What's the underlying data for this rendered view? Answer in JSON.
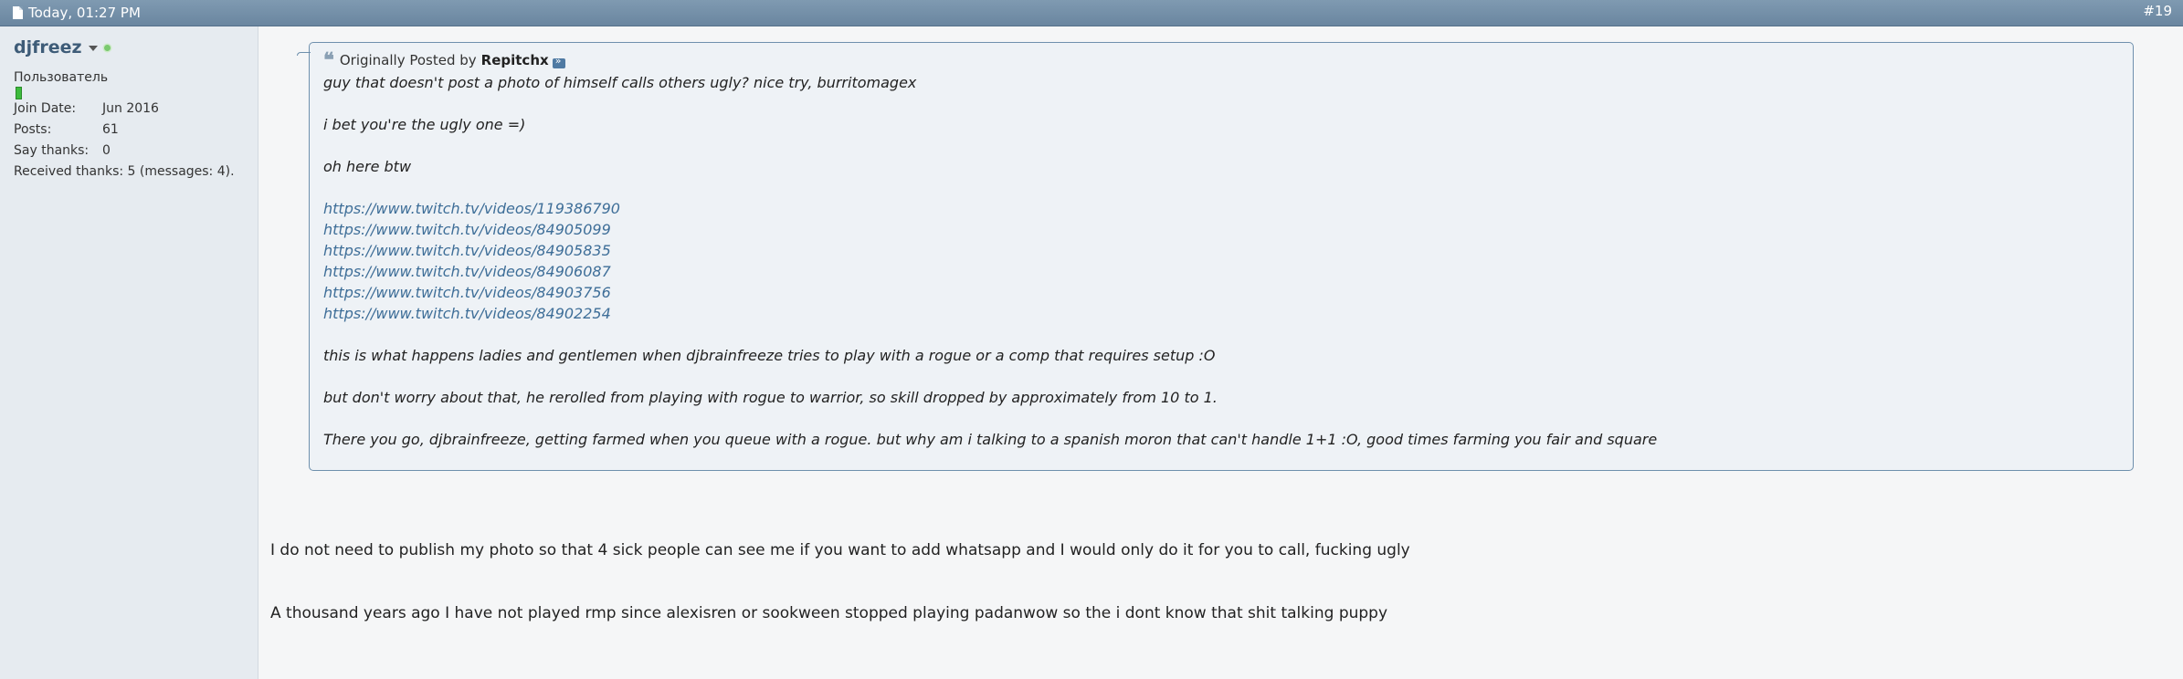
{
  "post": {
    "date": "Today, 01:27 PM",
    "number": "#19"
  },
  "user": {
    "name": "djfreez",
    "rank": "Пользователь",
    "stats": [
      {
        "label": "Join Date:",
        "value": "Jun 2016"
      },
      {
        "label": "Posts:",
        "value": "61"
      },
      {
        "label": "Say thanks:",
        "value": "0"
      }
    ],
    "received": "Received thanks: 5 (messages: 4)."
  },
  "quote": {
    "prefix": "Originally Posted by",
    "author": "Repitchx",
    "lines": [
      "guy that doesn't post a photo of himself calls others ugly? nice try, burritomagex",
      "i bet you're the ugly one =)",
      "oh here btw"
    ],
    "links": [
      "https://www.twitch.tv/videos/119386790",
      "https://www.twitch.tv/videos/84905099",
      "https://www.twitch.tv/videos/84905835",
      "https://www.twitch.tv/videos/84906087",
      "https://www.twitch.tv/videos/84903756",
      "https://www.twitch.tv/videos/84902254"
    ],
    "after": [
      "this is what happens ladies and gentlemen when djbrainfreeze tries to play with a rogue or a comp that requires setup :O",
      "but don't worry about that, he rerolled from playing with rogue to warrior, so skill dropped by approximately from 10 to 1.",
      "There you go, djbrainfreeze, getting farmed when you queue with a rogue. but why am i talking to a spanish moron that can't handle 1+1 :O, good times farming you fair and square"
    ]
  },
  "reply": [
    "I do not need to publish my photo so that 4 sick people can see me if you want to add whatsapp and I would only do it for you to call, fucking ugly",
    "A thousand years ago I have not played rmp since alexisren or sookween stopped playing padanwow so the i dont know that shit talking puppy"
  ]
}
